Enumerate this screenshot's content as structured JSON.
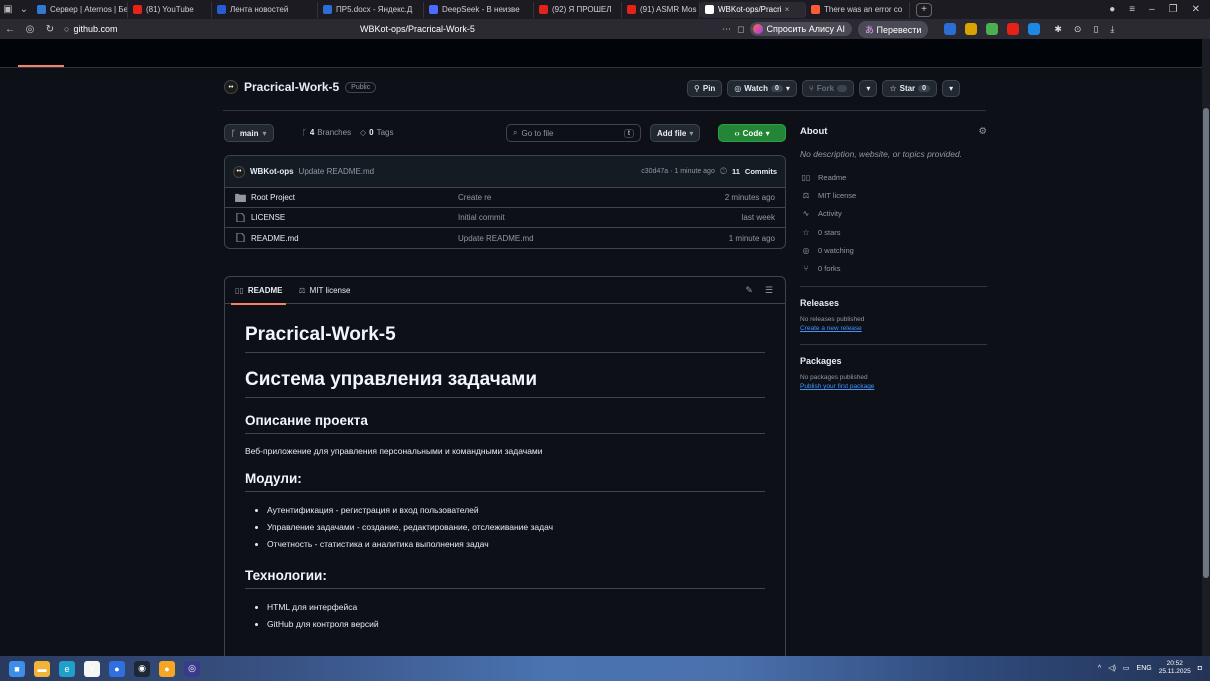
{
  "browser": {
    "tabs": [
      {
        "label": "Сервер | Aternos | Бе",
        "icon": "aternos-icon",
        "color": "#2e7bd6"
      },
      {
        "label": "(81) YouTube",
        "icon": "youtube-icon",
        "color": "#e62117"
      },
      {
        "label": "Лента новостей",
        "icon": "news-icon",
        "color": "#2a5bd7"
      },
      {
        "label": "ПР5.docx - Яндекс.Д",
        "icon": "docx-icon",
        "color": "#2b6fd6"
      },
      {
        "label": "DeepSeek - В неизве",
        "icon": "deepseek-icon",
        "color": "#4d6bfe"
      },
      {
        "label": "(92) Я ПРОШЕЛ",
        "icon": "youtube-icon",
        "color": "#e62117"
      },
      {
        "label": "(91) ASMR Mos",
        "icon": "youtube-icon",
        "color": "#e62117"
      },
      {
        "label": "WBKot-ops/Pracri",
        "icon": "github-icon",
        "color": "#ffffff",
        "active": true
      },
      {
        "label": "There was an error co",
        "icon": "error-icon",
        "color": "#ff5a36"
      }
    ],
    "tab_close_glyph": "×",
    "new_tab_glyph": "+",
    "url": "github.com",
    "page_title": "WBKot-ops/Pracrical-Work-5",
    "alisa_label": "Спросить Алису AI",
    "translate_label": "Перевести",
    "ext_colors": [
      "#2b6fd6",
      "#d9a400",
      "#4caf50",
      "#e62117",
      "#1e88e5"
    ]
  },
  "repo": {
    "owner_avatar_text": "••",
    "name": "Pracrical-Work-5",
    "visibility": "Public",
    "pin_label": "Pin",
    "watch_label": "Watch",
    "watch_count": "0",
    "fork_label": "Fork",
    "fork_count": "0",
    "star_label": "Star",
    "star_count": "0"
  },
  "toolbar": {
    "branch": "main",
    "branches_count": "4",
    "branches_label": "Branches",
    "tags_count": "0",
    "tags_label": "Tags",
    "goto_placeholder": "Go to file",
    "goto_shortcut": "t",
    "addfile_label": "Add file",
    "code_label": "Code"
  },
  "commit": {
    "author": "WBKot-ops",
    "message": "Update README.md",
    "hash_time": "c30d47a · 1 minute ago",
    "commits_count": "11",
    "commits_label": "Commits"
  },
  "files": [
    {
      "name": "Root Project",
      "type": "folder",
      "message": "Create re",
      "time": "2 minutes ago"
    },
    {
      "name": "LICENSE",
      "type": "file",
      "message": "Initial commit",
      "time": "last week"
    },
    {
      "name": "README.md",
      "type": "file",
      "message": "Update README.md",
      "time": "1 minute ago"
    }
  ],
  "readme_tabs": {
    "readme": "README",
    "license": "MIT license"
  },
  "readme": {
    "title": "Pracrical-Work-5",
    "subtitle": "Система управления задачами",
    "desc_heading": "Описание проекта",
    "desc_text": "Веб-приложение для управления персональными и командными задачами",
    "modules_heading": "Модули:",
    "modules": [
      "Аутентификация - регистрация и вход пользователей",
      "Управление задачами - создание, редактирование, отслеживание задач",
      "Отчетность - статистика и аналитика выполнения задач"
    ],
    "tech_heading": "Технологии:",
    "tech": [
      "HTML для интерфейса",
      "GitHub для контроля версий"
    ]
  },
  "about": {
    "title": "About",
    "description": "No description, website, or topics provided.",
    "readme": "Readme",
    "license": "MIT license",
    "activity": "Activity",
    "stars": "0 stars",
    "watching": "0 watching",
    "forks": "0 forks"
  },
  "releases": {
    "title": "Releases",
    "note": "No releases published",
    "link": "Create a new release"
  },
  "packages": {
    "title": "Packages",
    "note": "No packages published",
    "link": "Publish your first package"
  },
  "taskbar": {
    "lang": "ENG",
    "time": "20:52",
    "date": "25.11.2025",
    "apps": [
      {
        "name": "windows-start-icon",
        "color": "#3b8eea",
        "glyph": "■"
      },
      {
        "name": "file-explorer-icon",
        "color": "#f2b437",
        "glyph": "▬"
      },
      {
        "name": "edge-icon",
        "color": "#1fa0c9",
        "glyph": "e"
      },
      {
        "name": "yandex-browser-icon",
        "color": "#f5f5f5",
        "glyph": "Y"
      },
      {
        "name": "app-icon-1",
        "color": "#2f6fe0",
        "glyph": "●"
      },
      {
        "name": "steam-icon",
        "color": "#1b2838",
        "glyph": "◉"
      },
      {
        "name": "app-icon-2",
        "color": "#f6a623",
        "glyph": "●"
      },
      {
        "name": "app-icon-3",
        "color": "#3a3a8a",
        "glyph": "◎"
      }
    ]
  }
}
